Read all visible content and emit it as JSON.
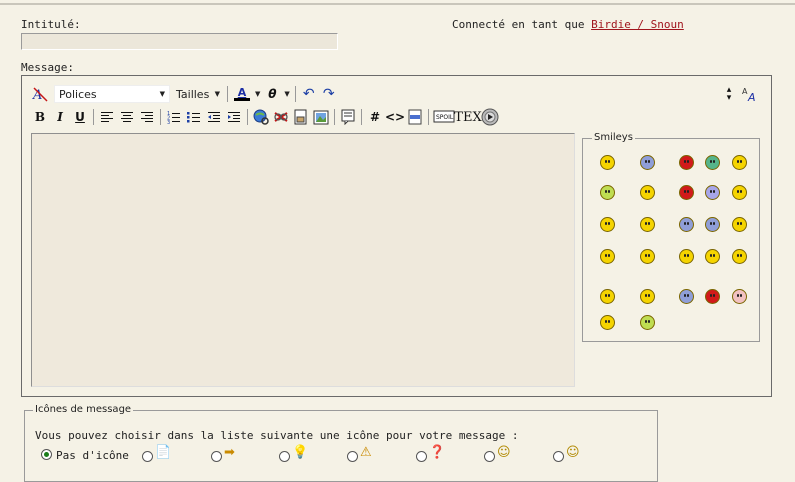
{
  "form": {
    "title_label": "Intitulé:",
    "title_value": "",
    "connected_prefix": "Connecté en tant que",
    "connected_user": "Birdie / Snoun",
    "message_label": "Message:"
  },
  "toolbar": {
    "font_select": "Polices",
    "size_select": "Tailles",
    "text_color_letter": "A",
    "hash_label": "#",
    "code_label": "<>",
    "tex_label": "TEX",
    "buttons": [
      "eraser",
      "font-family",
      "font-size",
      "text-color",
      "special-char",
      "undo",
      "redo",
      "bold",
      "italic",
      "underline",
      "align-left",
      "align-center",
      "align-right",
      "ordered-list",
      "unordered-list",
      "outdent",
      "indent",
      "link",
      "unlink",
      "insert-file",
      "insert-image",
      "quote",
      "hash",
      "code",
      "php",
      "spoiler",
      "tex",
      "video"
    ]
  },
  "smileys": {
    "legend": "Smileys",
    "rows": [
      [
        "smile",
        "sad-blue",
        "angry-red",
        "grin-teal",
        "happy"
      ],
      [
        "wink-green",
        "cool-sunglasses",
        "mad-red",
        "confused-purple",
        "question"
      ],
      [
        "help",
        "angel-wings",
        "blue-face",
        "rolleyes-blue",
        "glasses-geek"
      ],
      [
        "laugh",
        "love",
        "reading",
        "chinese-hat",
        "smile-small"
      ],
      [
        "thinking",
        "big-smile",
        "blue-sad",
        "red-devil",
        "pink-face"
      ],
      [
        "neutral",
        "green-sick"
      ]
    ],
    "colors": {
      "yellow": "#f5d400",
      "blue": "#8f9ed8",
      "red": "#d11a1a",
      "teal": "#55b48a",
      "purple": "#a7a6e8",
      "pink": "#f2c1c1",
      "green": "#bfdd52"
    }
  },
  "message_icons": {
    "legend": "Icônes de message",
    "instructions": "Vous pouvez choisir dans la liste suivante une icône pour votre message :",
    "no_icon_label": "Pas d'icône",
    "selected": "none",
    "icons": [
      "document",
      "arrow-right",
      "lightbulb",
      "warning",
      "question",
      "smile",
      "smile-wink"
    ]
  }
}
